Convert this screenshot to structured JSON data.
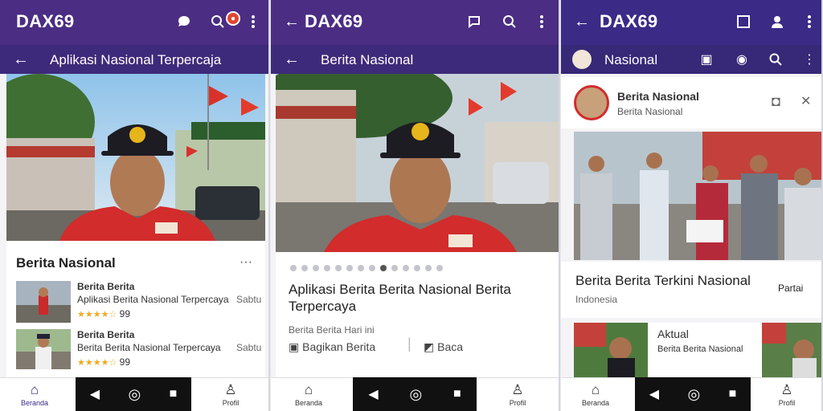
{
  "app": {
    "brand": "DAX69"
  },
  "phone1": {
    "subtitle": "Aplikasi Nasional Terpercaja",
    "section_title": "Berita Nasional",
    "items": [
      {
        "title": "Berita Berita",
        "subtitle": "Aplikasi Berita Nasional Terpercaya",
        "rating": "★★★★☆",
        "count": "99",
        "meta": "Sabtu"
      },
      {
        "title": "Berita Berita",
        "subtitle": "Berita Berita Nasional Terpercaya",
        "rating": "★★★★☆",
        "count": "99",
        "meta": "Sabtu"
      }
    ],
    "nav": {
      "home": "Beranda",
      "profile": "Profil"
    }
  },
  "phone2": {
    "subtitle": "Berita Nasional",
    "headline": "Aplikasi Berita Berita Nasional Berita Terpercaya",
    "meta": "Berita Berita Hari ini",
    "action_share": "Bagikan Berita",
    "action_save": "Baca",
    "nav": {
      "home": "Beranda",
      "profile": "Profil"
    }
  },
  "phone3": {
    "subtitle": "Nasional",
    "card_title": "Berita Nasional",
    "card_sub": "Berita Nasional",
    "headline": "Berita Berita Terkini Nasional",
    "meta": "Indonesia",
    "side_meta": "Partai",
    "side_title": "Aktual",
    "side_text": "Berita Berita Nasional",
    "nav": {
      "home": "Beranda",
      "profile": "Profil"
    }
  },
  "colors": {
    "primary": "#4b2d83",
    "accent": "#e1452f"
  },
  "icons": [
    "back-arrow-icon",
    "chat-icon",
    "search-icon",
    "more-vert-icon",
    "home-icon",
    "person-icon",
    "bookmark-icon",
    "share-icon"
  ]
}
